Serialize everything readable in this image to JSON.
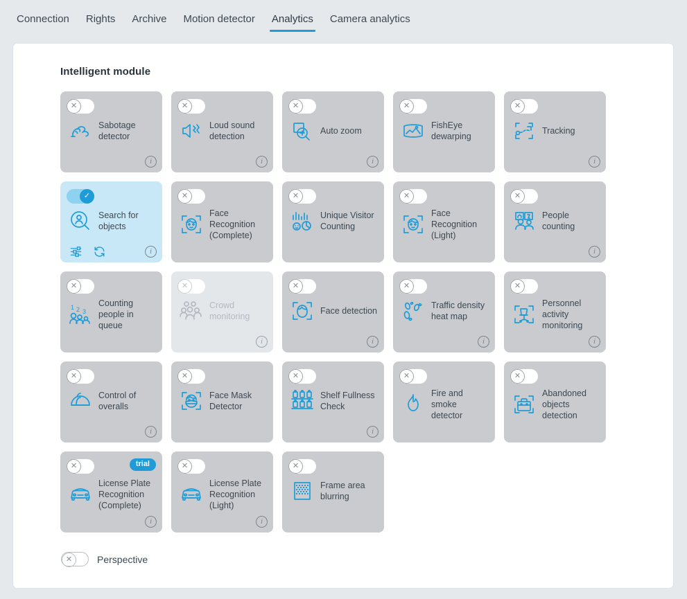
{
  "tabs": [
    {
      "label": "Connection",
      "active": false
    },
    {
      "label": "Rights",
      "active": false
    },
    {
      "label": "Archive",
      "active": false
    },
    {
      "label": "Motion detector",
      "active": false
    },
    {
      "label": "Analytics",
      "active": true
    },
    {
      "label": "Camera analytics",
      "active": false
    }
  ],
  "section": {
    "title": "Intelligent module"
  },
  "colors": {
    "accent": "#1f9cd8",
    "card_bg": "#c9cbce",
    "card_bg_disabled": "#e4e7ea",
    "card_bg_on": "#c9e8f7",
    "page_bg": "#e6e9ec",
    "panel_bg": "#ffffff",
    "text": "#3d4852"
  },
  "toggle": {
    "off_glyph": "✕",
    "on_glyph": "✓"
  },
  "info_glyph": "i",
  "modules": [
    {
      "label": "Sabotage detector",
      "icon": "sabotage-detector-icon",
      "state": "off",
      "info": true,
      "trial": false,
      "disabled": false,
      "actions": false
    },
    {
      "label": "Loud sound detection",
      "icon": "loud-sound-icon",
      "state": "off",
      "info": true,
      "trial": false,
      "disabled": false,
      "actions": false
    },
    {
      "label": "Auto zoom",
      "icon": "auto-zoom-icon",
      "state": "off",
      "info": true,
      "trial": false,
      "disabled": false,
      "actions": false
    },
    {
      "label": "FishEye dewarping",
      "icon": "fisheye-dewarping-icon",
      "state": "off",
      "info": false,
      "trial": false,
      "disabled": false,
      "actions": false
    },
    {
      "label": "Tracking",
      "icon": "tracking-icon",
      "state": "off",
      "info": true,
      "trial": false,
      "disabled": false,
      "actions": false
    },
    {
      "label": "Search for objects",
      "icon": "search-for-objects-icon",
      "state": "on",
      "info": true,
      "trial": false,
      "disabled": false,
      "actions": true
    },
    {
      "label": "Face Recognition (Complete)",
      "icon": "face-recognition-complete-icon",
      "state": "off",
      "info": false,
      "trial": false,
      "disabled": false,
      "actions": false
    },
    {
      "label": "Unique Visitor Counting",
      "icon": "unique-visitor-counting-icon",
      "state": "off",
      "info": false,
      "trial": false,
      "disabled": false,
      "actions": false
    },
    {
      "label": "Face Recognition (Light)",
      "icon": "face-recognition-light-icon",
      "state": "off",
      "info": false,
      "trial": false,
      "disabled": false,
      "actions": false
    },
    {
      "label": "People counting",
      "icon": "people-counting-icon",
      "state": "off",
      "info": true,
      "trial": false,
      "disabled": false,
      "actions": false
    },
    {
      "label": "Counting people in queue",
      "icon": "counting-people-in-queue-icon",
      "state": "off",
      "info": false,
      "trial": false,
      "disabled": false,
      "actions": false
    },
    {
      "label": "Crowd monitoring",
      "icon": "crowd-monitoring-icon",
      "state": "off",
      "info": true,
      "trial": false,
      "disabled": true,
      "actions": false
    },
    {
      "label": "Face detection",
      "icon": "face-detection-icon",
      "state": "off",
      "info": true,
      "trial": false,
      "disabled": false,
      "actions": false
    },
    {
      "label": "Traffic density heat map",
      "icon": "traffic-density-heat-map-icon",
      "state": "off",
      "info": true,
      "trial": false,
      "disabled": false,
      "actions": false
    },
    {
      "label": "Personnel activity monitoring",
      "icon": "personnel-activity-monitoring-icon",
      "state": "off",
      "info": true,
      "trial": false,
      "disabled": false,
      "actions": false
    },
    {
      "label": "Control of overalls",
      "icon": "control-of-overalls-icon",
      "state": "off",
      "info": true,
      "trial": false,
      "disabled": false,
      "actions": false
    },
    {
      "label": "Face Mask Detector",
      "icon": "face-mask-detector-icon",
      "state": "off",
      "info": false,
      "trial": false,
      "disabled": false,
      "actions": false
    },
    {
      "label": "Shelf Fullness Check",
      "icon": "shelf-fullness-check-icon",
      "state": "off",
      "info": true,
      "trial": false,
      "disabled": false,
      "actions": false
    },
    {
      "label": "Fire and smoke detector",
      "icon": "fire-and-smoke-detector-icon",
      "state": "off",
      "info": false,
      "trial": false,
      "disabled": false,
      "actions": false
    },
    {
      "label": "Abandoned objects detection",
      "icon": "abandoned-objects-detection-icon",
      "state": "off",
      "info": false,
      "trial": false,
      "disabled": false,
      "actions": false
    },
    {
      "label": "License Plate Recognition (Complete)",
      "icon": "license-plate-recognition-icon",
      "state": "off",
      "info": true,
      "trial": true,
      "trial_label": "trial",
      "disabled": false,
      "actions": false
    },
    {
      "label": "License Plate Recognition (Light)",
      "icon": "license-plate-recognition-icon",
      "state": "off",
      "info": true,
      "trial": false,
      "disabled": false,
      "actions": false
    },
    {
      "label": "Frame area blurring",
      "icon": "frame-area-blurring-icon",
      "state": "off",
      "info": false,
      "trial": false,
      "disabled": false,
      "actions": false
    }
  ],
  "perspective": {
    "label": "Perspective",
    "state": "off"
  },
  "active_card_actions": [
    {
      "name": "settings-sliders-icon"
    },
    {
      "name": "refresh-sync-icon"
    }
  ]
}
